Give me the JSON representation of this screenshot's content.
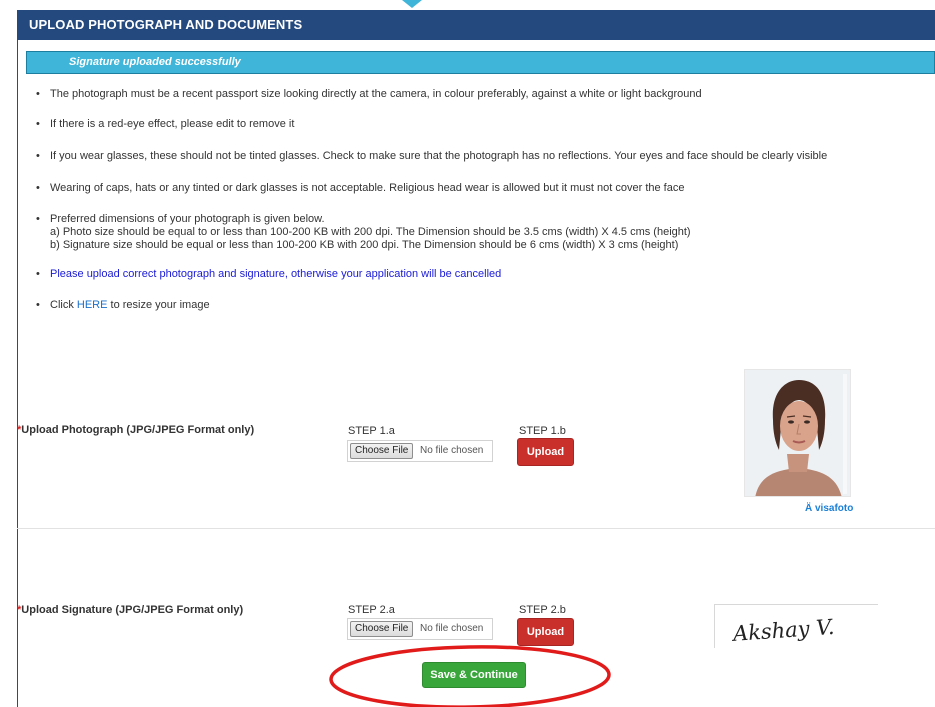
{
  "header": {
    "title": "UPLOAD PHOTOGRAPH AND DOCUMENTS"
  },
  "alert": {
    "message": "Signature uploaded successfully"
  },
  "instructions": {
    "i1": "The photograph must be a recent passport size looking directly at the camera, in colour preferably, against a white or light background",
    "i2": "If there is a red-eye effect, please edit to remove it",
    "i3": "If you wear glasses, these should not be tinted glasses. Check to make sure that the photograph has no reflections. Your eyes and face should be clearly visible",
    "i4": "Wearing of caps, hats or any tinted or dark glasses is not acceptable. Religious head wear is allowed but it must not cover the face",
    "i5_title": "Preferred dimensions of your photograph is given below.",
    "i5_a": "a) Photo size should be equal to or less than 100-200 KB with 200 dpi. The Dimension should be 3.5 cms (width) X 4.5 cms (height)",
    "i5_b": "b) Signature size should be equal or less than 100-200 KB with 200 dpi. The Dimension should be 6 cms (width) X 3 cms (height)",
    "i6": "Please upload correct photograph and signature, otherwise your application will be cancelled",
    "i7_prefix": "Click",
    "i7_link": "HERE",
    "i7_suffix": "to resize your image"
  },
  "photo_section": {
    "asterisk": "*",
    "label": "Upload Photograph (JPG/JPEG Format only)",
    "step_a": "STEP 1.a",
    "step_b": "STEP 1.b",
    "choose_label": "Choose File",
    "no_file": "No file chosen",
    "upload_label": "Upload",
    "watermark": "Ä visafoto"
  },
  "signature_section": {
    "asterisk": "*",
    "label": "Upload Signature (JPG/JPEG Format only)",
    "step_a": "STEP 2.a",
    "step_b": "STEP 2.b",
    "choose_label": "Choose File",
    "no_file": "No file chosen",
    "upload_label": "Upload",
    "signature_text": "Akshay V."
  },
  "actions": {
    "save_label": "Save & Continue"
  },
  "colors": {
    "header_bg": "#24497f",
    "alert_bg": "#3fb5d9",
    "upload_btn": "#c9302c",
    "save_btn": "#38a63a",
    "annotation": "#e11a1a",
    "link": "#1a6fc9"
  }
}
